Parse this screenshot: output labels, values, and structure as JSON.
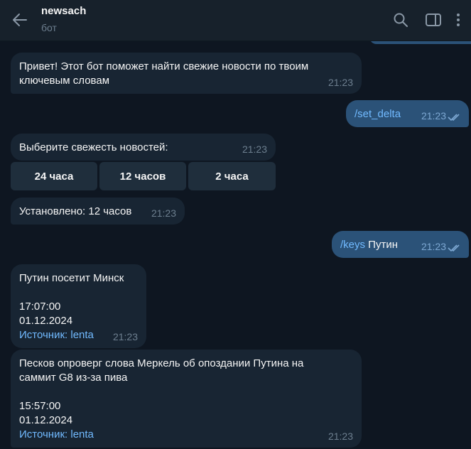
{
  "header": {
    "title": "newsach",
    "subtitle": "бот",
    "back_icon": "arrow-left-icon",
    "search_icon": "search-icon",
    "sidebar_icon": "sidebar-toggle-icon",
    "menu_icon": "kebab-menu-icon"
  },
  "messages": {
    "m1": {
      "text_line1": "Привет! Этот бот поможет найти свежие новости по твоим",
      "text_line2": "ключевым словам",
      "time": "21:23"
    },
    "m2": {
      "command": "/set_delta",
      "time": "21:23"
    },
    "m3": {
      "text": "Выберите свежесть новостей:",
      "time": "21:23"
    },
    "keyboard": {
      "b1": "24 часа",
      "b2": "12 часов",
      "b3": "2 часа"
    },
    "m4": {
      "text": "Установлено: 12 часов",
      "time": "21:23"
    },
    "m5": {
      "command": "/keys",
      "arg": " Путин",
      "time": "21:23"
    },
    "m6": {
      "title": "Путин посетит Минск",
      "clock": "17:07:00",
      "date": "01.12.2024",
      "source_label": "Источник: ",
      "source_link": "lenta",
      "time": "21:23"
    },
    "m7": {
      "title_line1": "Песков опроверг слова Меркель об опоздании Путина на",
      "title_line2": "саммит G8 из-за пива",
      "clock": "15:57:00",
      "date": "01.12.2024",
      "source_label": "Источник: ",
      "source_link": "lenta",
      "time": "21:23"
    }
  },
  "colors": {
    "background": "#0e1621",
    "header": "#17212b",
    "incoming_bubble": "#182533",
    "outgoing_bubble": "#2b5278",
    "link": "#71baff",
    "muted": "#6d7f8f"
  }
}
